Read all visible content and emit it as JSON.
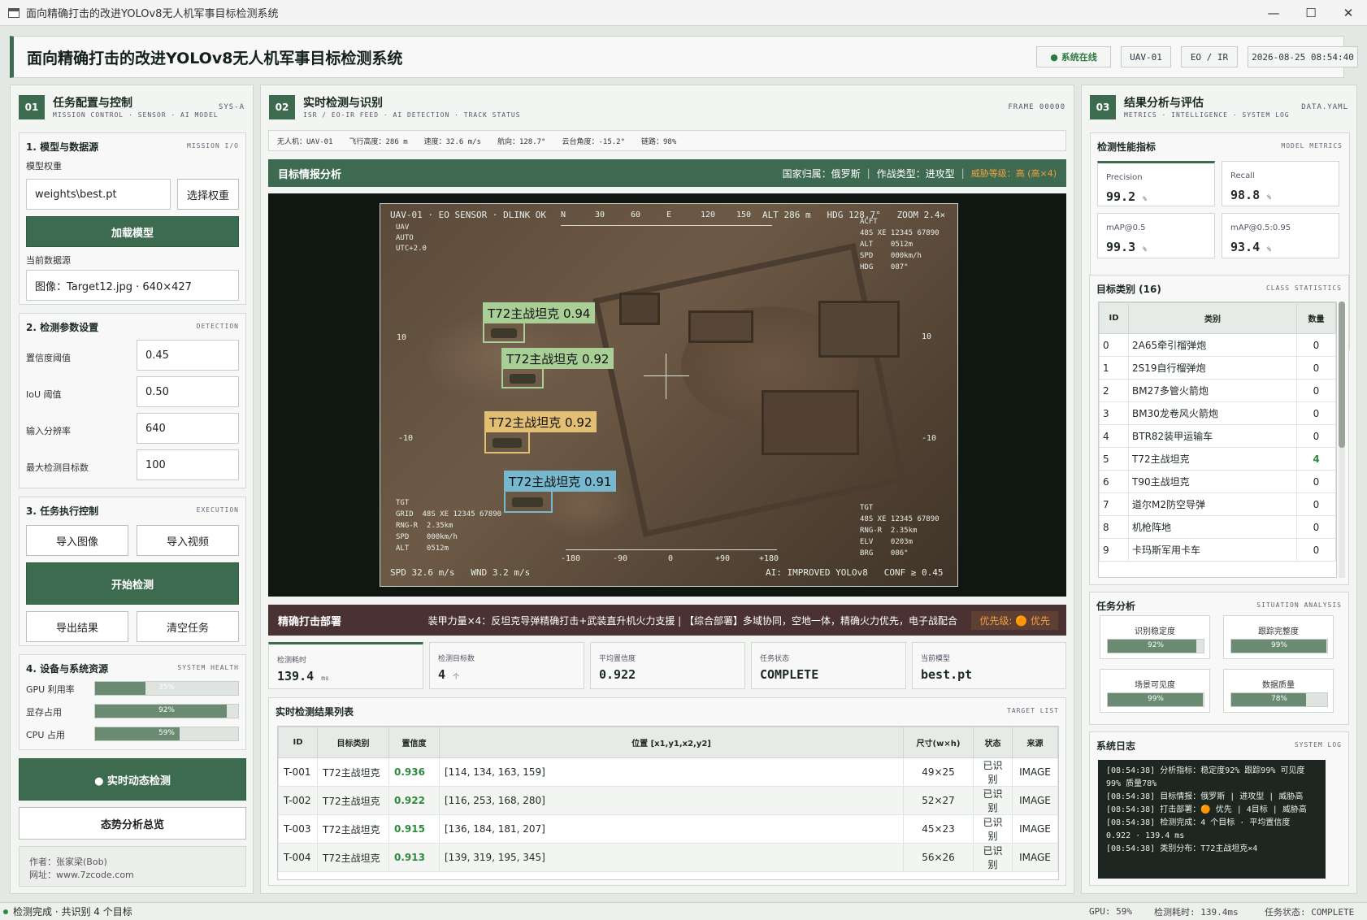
{
  "window": {
    "title": "面向精确打击的改进YOLOv8无人机军事目标检测系统",
    "min": "—",
    "max": "☐",
    "close": "✕"
  },
  "header": {
    "title": "面向精确打击的改进YOLOv8无人机军事目标检测系统",
    "status": "● 系统在线",
    "uav": "UAV-01",
    "sensor": "EO / IR",
    "datetime": "2026-08-25 08:54:40"
  },
  "left": {
    "num": "01",
    "title": "任务配置与控制",
    "subtitle": "MISSION CONTROL · SENSOR · AI MODEL",
    "tag": "SYS-A",
    "model": {
      "title": "1. 模型与数据源",
      "tag": "MISSION I/O",
      "weights_label": "模型权重",
      "weights_value": "weights\\best.pt",
      "choose_btn": "选择权重",
      "load_btn": "加载模型",
      "source_label": "当前数据源",
      "source_value": "图像：Target12.jpg · 640×427"
    },
    "params": {
      "title": "2. 检测参数设置",
      "tag": "DETECTION",
      "conf_label": "置信度阈值",
      "conf": "0.45",
      "iou_label": "IoU 阈值",
      "iou": "0.50",
      "res_label": "输入分辨率",
      "res": "640",
      "max_label": "最大检测目标数",
      "max": "100"
    },
    "exec": {
      "title": "3. 任务执行控制",
      "tag": "EXECUTION",
      "import_img": "导入图像",
      "import_vid": "导入视频",
      "start": "开始检测",
      "export": "导出结果",
      "clear": "清空任务"
    },
    "sys": {
      "title": "4. 设备与系统资源",
      "tag": "SYSTEM HEALTH",
      "gpu_label": "GPU 利用率",
      "gpu": "35%",
      "gpu_frac": 0.35,
      "vram_label": "显存占用",
      "vram": "92%",
      "vram_frac": 0.92,
      "cpu_label": "CPU 占用",
      "cpu": "59%",
      "cpu_frac": 0.59
    },
    "realtime_btn": "● 实时动态检测",
    "overview_btn": "态势分析总览",
    "author": "作者：张家梁(Bob)",
    "site": "网址：www.7zcode.com"
  },
  "center": {
    "num": "02",
    "title": "实时检测与识别",
    "subtitle": "ISR / EO-IR FEED · AI DETECTION · TRACK STATUS",
    "tag": "FRAME 00000",
    "telemetry": [
      "无人机：UAV-01",
      "飞行高度：286 m",
      "速度：32.6 m/s",
      "航向：128.7°",
      "云台角度：-15.2°",
      "链路：98%"
    ],
    "intel": {
      "title": "目标情报分析",
      "nation": "国家归属：俄罗斯",
      "type": "作战类型：进攻型",
      "threat": "威胁等级：高 (高×4)"
    },
    "hud": {
      "top_left": "UAV-01 · EO SENSOR · DLINK OK",
      "top_right": "ALT 286 m   HDG 128.7°   ZOOM 2.4×",
      "tl_block": "UAV\nAUTO\nUTC+2.0",
      "acft": "ACFT\n48S XE 12345 67890\nALT    0512m\nSPD    000km/h\nHDG    087°",
      "tgt_left": "TGT\nGRID  48S XE 12345 67890\nRNG-R  2.35km\nSPD    000km/h\nALT    0512m",
      "tgt_right": "TGT\n48S XE 12345 67890\nRNG-R  2.35km\nELV    0203m\nBRG    086°",
      "bottom_left": "SPD 32.6 m/s   WND 3.2 m/s",
      "bottom_right": "AI: IMPROVED YOLOv8   CONF ≥ 0.45",
      "ticks_top": [
        "N",
        "30",
        "60",
        "E",
        "120",
        "150"
      ],
      "ticks_bottom": [
        "-180",
        "-90",
        "0",
        "+90",
        "+180"
      ],
      "scale_left": [
        "10",
        "-10"
      ],
      "scale_right": [
        "10",
        "-10"
      ]
    },
    "detections": [
      {
        "label": "T72主战坦克  0.94"
      },
      {
        "label": "T72主战坦克  0.92"
      },
      {
        "label": "T72主战坦克  0.92"
      },
      {
        "label": "T72主战坦克  0.91"
      }
    ],
    "det_colors": [
      "#a9cf97",
      "#a9cf97",
      "#e2bf73",
      "#78b8cf"
    ],
    "strike": {
      "title": "精确打击部署",
      "text": "装甲力量×4：反坦克导弹精确打击+武装直升机火力支援 | 【综合部署】多域协同，空地一体，精确火力优先，电子战配合",
      "priority": "优先级: 🟠 优先"
    },
    "stats": [
      {
        "label": "检测耗时",
        "value": "139.4",
        "unit": "ms"
      },
      {
        "label": "检测目标数",
        "value": "4",
        "unit": "个"
      },
      {
        "label": "平均置信度",
        "value": "0.922",
        "unit": ""
      },
      {
        "label": "任务状态",
        "value": "COMPLETE",
        "unit": ""
      },
      {
        "label": "当前模型",
        "value": "best.pt",
        "unit": ""
      }
    ],
    "results": {
      "title": "实时检测结果列表",
      "tag": "TARGET LIST",
      "headers": [
        "ID",
        "目标类别",
        "置信度",
        "位置 [x1,y1,x2,y2]",
        "尺寸(w×h)",
        "状态",
        "来源"
      ],
      "rows": [
        [
          "T-001",
          "T72主战坦克",
          "0.936",
          "[114, 134, 163, 159]",
          "49×25",
          "已识别",
          "IMAGE"
        ],
        [
          "T-002",
          "T72主战坦克",
          "0.922",
          "[116, 253, 168, 280]",
          "52×27",
          "已识别",
          "IMAGE"
        ],
        [
          "T-003",
          "T72主战坦克",
          "0.915",
          "[136, 184, 181, 207]",
          "45×23",
          "已识别",
          "IMAGE"
        ],
        [
          "T-004",
          "T72主战坦克",
          "0.913",
          "[139, 319, 195, 345]",
          "56×26",
          "已识别",
          "IMAGE"
        ]
      ]
    }
  },
  "right": {
    "num": "03",
    "title": "结果分析与评估",
    "subtitle": "METRICS · INTELLIGENCE · SYSTEM LOG",
    "tag": "DATA.YAML",
    "metrics": {
      "title": "检测性能指标",
      "tag": "MODEL METRICS",
      "items": [
        {
          "label": "Precision",
          "value": "99.2",
          "unit": "%"
        },
        {
          "label": "Recall",
          "value": "98.8",
          "unit": "%"
        },
        {
          "label": "mAP@0.5",
          "value": "99.3",
          "unit": "%"
        },
        {
          "label": "mAP@0.5:0.95",
          "value": "93.4",
          "unit": "%"
        }
      ]
    },
    "classes": {
      "title": "目标类别 (16)",
      "tag": "CLASS STATISTICS",
      "headers": [
        "ID",
        "类别",
        "数量"
      ],
      "rows": [
        [
          "0",
          "2A65牵引榴弹炮",
          "0"
        ],
        [
          "1",
          "2S19自行榴弹炮",
          "0"
        ],
        [
          "2",
          "BM27多管火箭炮",
          "0"
        ],
        [
          "3",
          "BM30龙卷风火箭炮",
          "0"
        ],
        [
          "4",
          "BTR82装甲运输车",
          "0"
        ],
        [
          "5",
          "T72主战坦克",
          "4"
        ],
        [
          "6",
          "T90主战坦克",
          "0"
        ],
        [
          "7",
          "道尔M2防空导弹",
          "0"
        ],
        [
          "8",
          "机枪阵地",
          "0"
        ],
        [
          "9",
          "卡玛斯军用卡车",
          "0"
        ]
      ]
    },
    "analysis": {
      "title": "任务分析",
      "tag": "SITUATION ANALYSIS",
      "items": [
        {
          "label": "识别稳定度",
          "value": "92%",
          "frac": 0.92
        },
        {
          "label": "跟踪完整度",
          "value": "99%",
          "frac": 0.99
        },
        {
          "label": "场景可见度",
          "value": "99%",
          "frac": 0.99
        },
        {
          "label": "数据质量",
          "value": "78%",
          "frac": 0.78
        }
      ]
    },
    "log": {
      "title": "系统日志",
      "tag": "SYSTEM LOG",
      "lines": [
        "[08:54:38]  分析指标：稳定度92% 跟踪99% 可见度99% 质量78%",
        "[08:54:38]  目标情报：俄罗斯 | 进攻型 | 威胁高",
        "[08:54:38]  打击部署：🟠 优先 | 4目标 | 威胁高",
        "[08:54:38]  检测完成：4 个目标 · 平均置信度 0.922 · 139.4 ms",
        "[08:54:38]  类别分布：T72主战坦克×4"
      ]
    }
  },
  "statusbar": {
    "left": "检测完成 · 共识别 4 个目标",
    "gpu": "GPU: 59%",
    "time": "检测耗时: 139.4ms",
    "task": "任务状态: COMPLETE"
  },
  "colors": {
    "accent": "#3d6b4f",
    "threat": "#f0a040",
    "good": "#2e8b3e"
  }
}
